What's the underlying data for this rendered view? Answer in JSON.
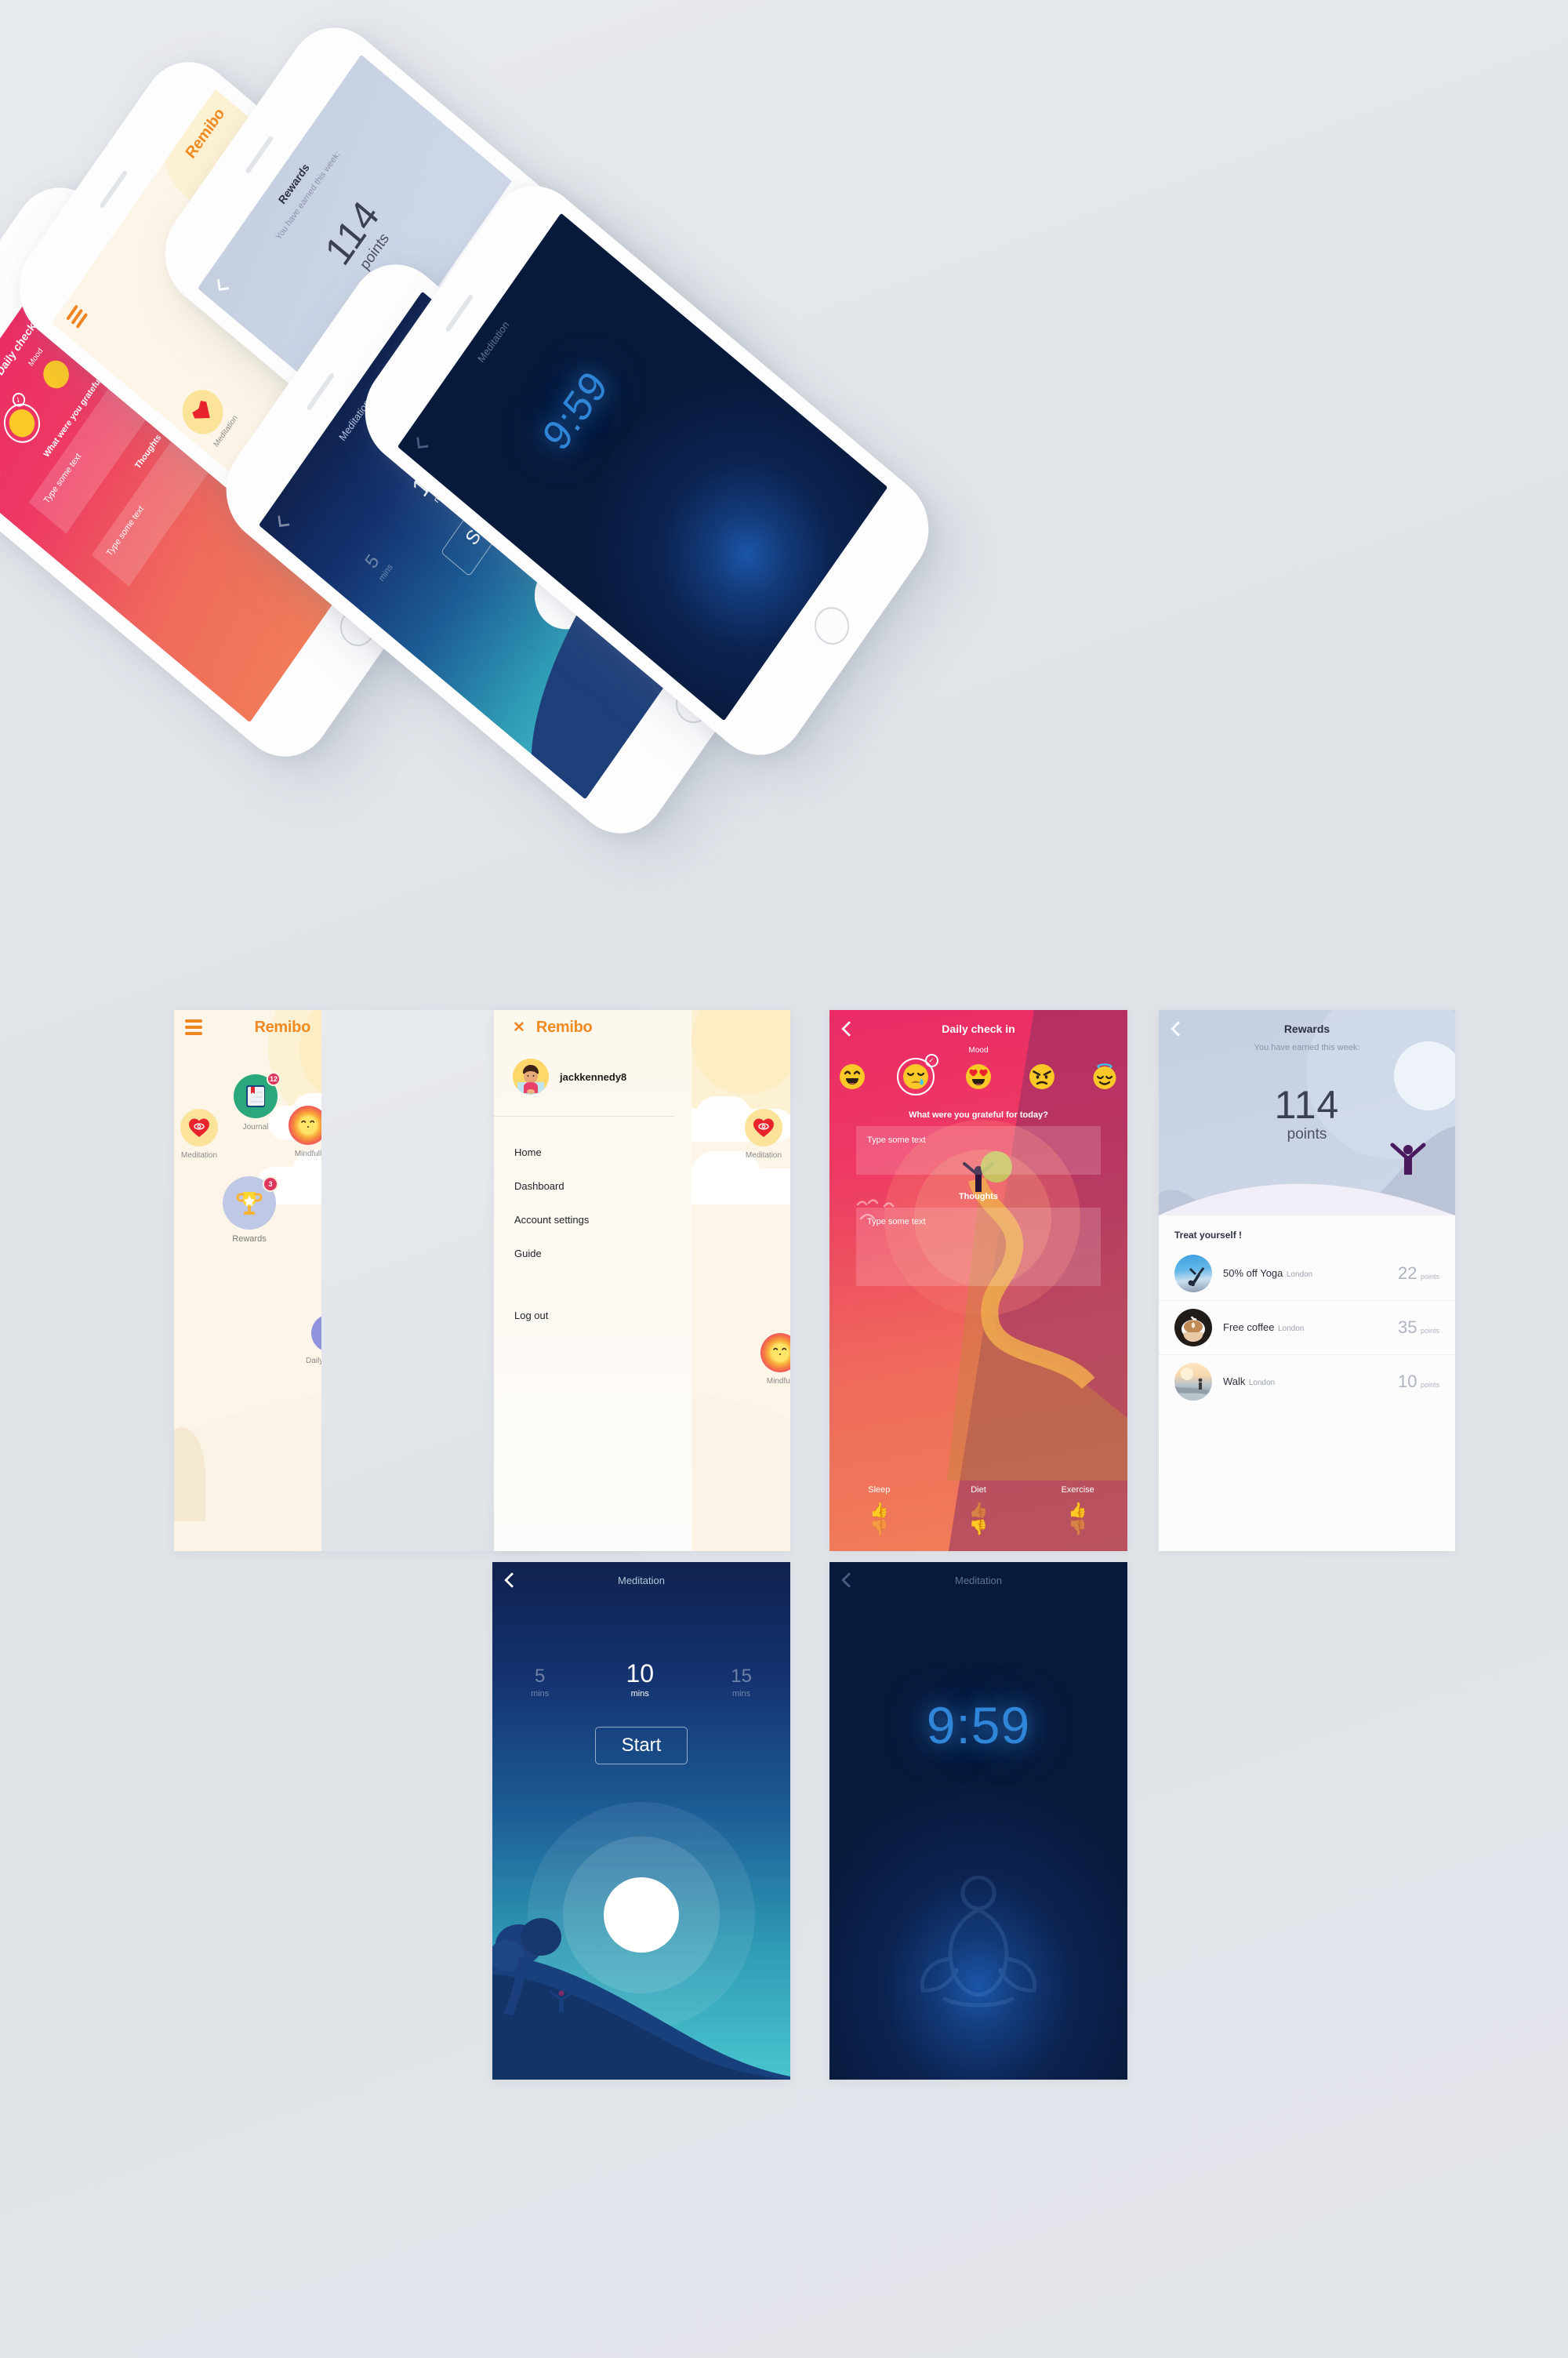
{
  "app": {
    "brand": "Remibo",
    "accent": "#f18a20",
    "page_bg": "#dfe3e8"
  },
  "home": {
    "menu_icon": "hamburger-icon",
    "brand": "Remibo",
    "tiles": [
      {
        "label": "Journal",
        "badge": "12",
        "icon": "journal-icon",
        "disc_color": "#2aa87c"
      },
      {
        "label": "Mindfull",
        "badge": "",
        "icon": "sun-face-icon",
        "disc_color": "#e5266c"
      },
      {
        "label": "Meditation",
        "badge": "",
        "icon": "heart-eye-icon",
        "disc_color": "#fbe49a"
      },
      {
        "label": "Rewards",
        "badge": "3",
        "icon": "trophy-icon",
        "disc_color": "#bcc6e3"
      },
      {
        "label": "Daily check in",
        "badge": "",
        "icon": "check-circle-icon",
        "disc_color": "#8b8fd6"
      }
    ]
  },
  "menu": {
    "close_icon": "close-icon",
    "brand": "Remibo",
    "avatar_icon": "user-avatar",
    "username": "jackkennedy8",
    "items": [
      {
        "label": "Home"
      },
      {
        "label": "Dashboard"
      },
      {
        "label": "Account settings"
      },
      {
        "label": "Guide"
      },
      {
        "label": "Log out"
      }
    ]
  },
  "checkin": {
    "back_icon": "back-chevron-icon",
    "title": "Daily check in",
    "mood_label": "Mood",
    "moods": [
      {
        "name": "laughing",
        "selected": false
      },
      {
        "name": "crying",
        "selected": true
      },
      {
        "name": "heart-eyes",
        "selected": false
      },
      {
        "name": "angry",
        "selected": false
      },
      {
        "name": "angel",
        "selected": false
      }
    ],
    "gratitude_question": "What were you grateful for today?",
    "gratitude_placeholder": "Type some text",
    "gratitude_value": "",
    "thoughts_label": "Thoughts",
    "thoughts_placeholder": "Type some text",
    "thoughts_value": "",
    "ratings": [
      {
        "label": "Sleep",
        "up": true,
        "down": false
      },
      {
        "label": "Diet",
        "up": false,
        "down": true
      },
      {
        "label": "Exercise",
        "up": true,
        "down": false
      }
    ],
    "thumb_up_icon": "thumbs-up-icon",
    "thumb_down_icon": "thumbs-down-icon"
  },
  "rewards": {
    "back_icon": "back-chevron-icon",
    "title": "Rewards",
    "subtitle": "You have earned this week:",
    "points_value": "114",
    "points_unit": "points",
    "section_title": "Treat yourself !",
    "items": [
      {
        "name": "50% off Yoga",
        "city": "London",
        "points": "22",
        "unit": "points",
        "thumb": "yoga-photo"
      },
      {
        "name": "Free coffee",
        "city": "London",
        "points": "35",
        "unit": "points",
        "thumb": "coffee-photo"
      },
      {
        "name": "Walk",
        "city": "London",
        "points": "10",
        "unit": "points",
        "thumb": "beach-photo"
      }
    ]
  },
  "meditation_timer": {
    "back_icon": "back-chevron-icon",
    "title": "Meditation",
    "durations": [
      {
        "value": "5",
        "unit": "mins",
        "selected": false
      },
      {
        "value": "10",
        "unit": "mins",
        "selected": true
      },
      {
        "value": "15",
        "unit": "mins",
        "selected": false
      }
    ],
    "start_label": "Start",
    "scene_icons": [
      "tree-icon",
      "person-arms-up-icon",
      "moon-icon"
    ]
  },
  "meditation_countdown": {
    "back_icon": "back-chevron-icon",
    "title": "Meditation",
    "time_remaining": "9:59",
    "scene_icons": [
      "lotus-figure-icon"
    ]
  }
}
